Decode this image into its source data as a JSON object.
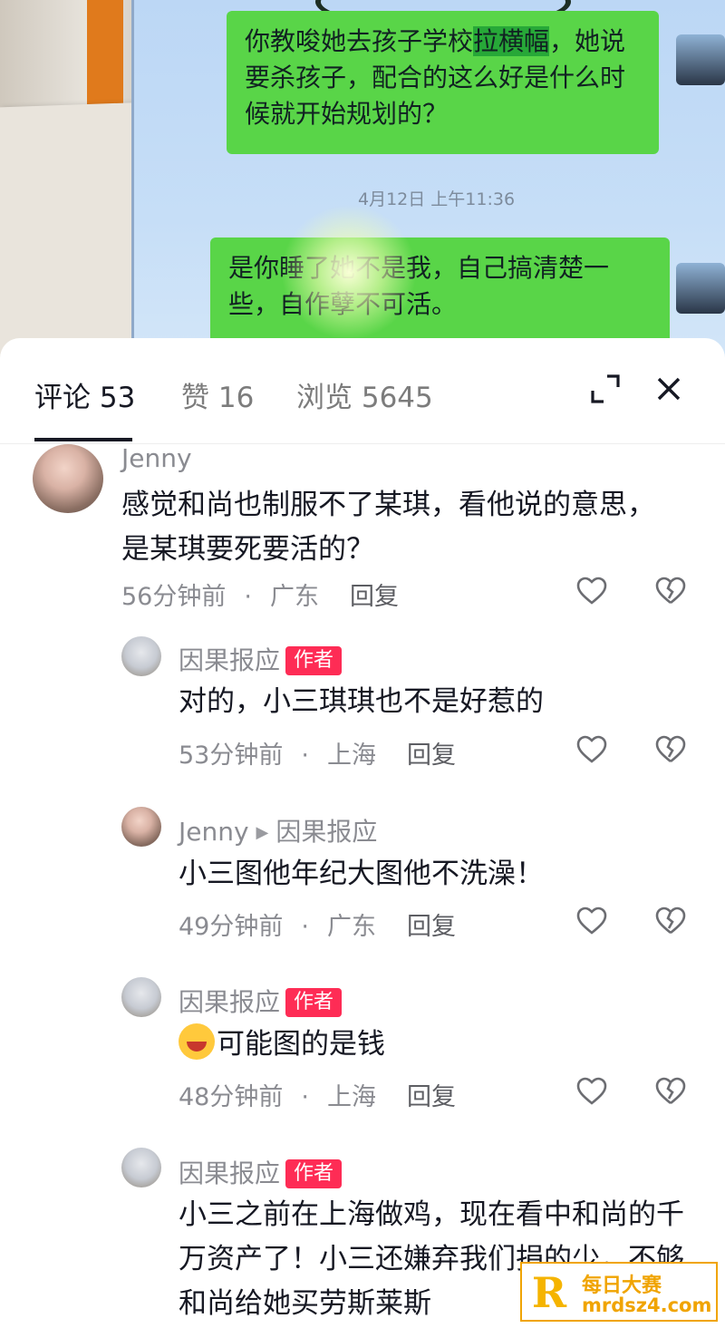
{
  "chat_photo": {
    "bubble1": {
      "before": "你教唆她去孩子学校",
      "highlight": "拉横幅",
      "after": "，她说要杀孩子，配合的这么好是什么时候就开始规划的？"
    },
    "timestamp": "4月12日 上午11:36",
    "bubble2": "是你睡了她不是我，自己搞清楚一些，自作孽不可活。"
  },
  "tabs": {
    "comments": "评论 53",
    "likes": "赞 16",
    "views": "浏览 5645"
  },
  "comments": [
    {
      "user": "Jenny",
      "text": "感觉和尚也制服不了某琪，看他说的意思，是某琪要死要活的？",
      "time": "56分钟前",
      "location": "广东",
      "reply": "回复"
    },
    {
      "user": "因果报应",
      "badge": "作者",
      "text": "对的，小三琪琪也不是好惹的",
      "time": "53分钟前",
      "location": "上海",
      "reply": "回复"
    },
    {
      "user": "Jenny",
      "reply_to": "因果报应",
      "text": "小三图他年纪大图他不洗澡！",
      "time": "49分钟前",
      "location": "广东",
      "reply": "回复"
    },
    {
      "user": "因果报应",
      "badge": "作者",
      "text": "可能图的是钱",
      "time": "48分钟前",
      "location": "上海",
      "reply": "回复"
    },
    {
      "user": "因果报应",
      "badge": "作者",
      "text": "小三之前在上海做鸡，现在看中和尚的千万资产了！小三还嫌弃我们捐的少，不够和尚给她买劳斯莱斯"
    }
  ],
  "watermark": {
    "line1": "每日大赛",
    "line2": "mrdsz4.com",
    "logo": "R"
  }
}
